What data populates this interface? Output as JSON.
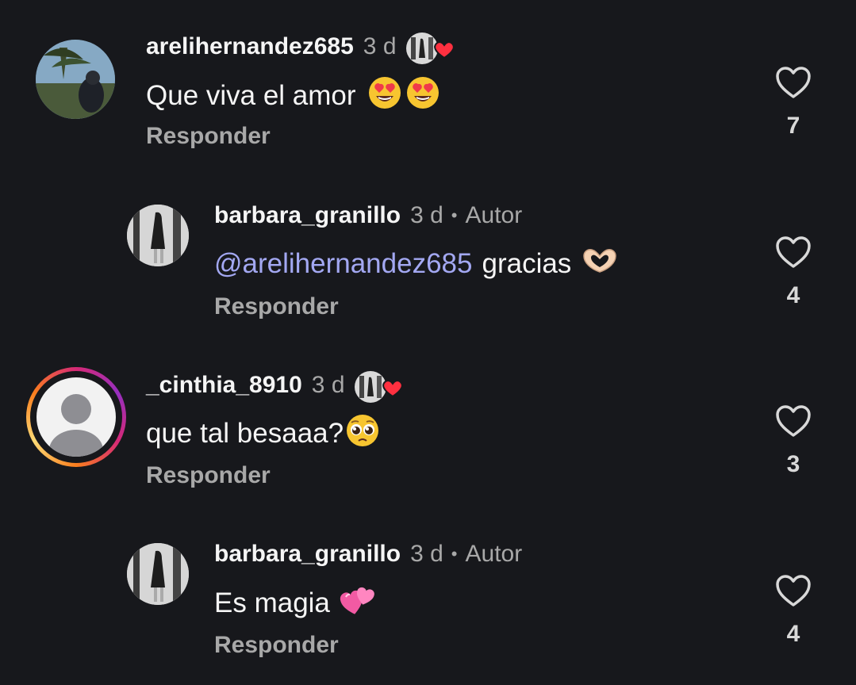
{
  "comments": [
    {
      "username": "arelihernandez685",
      "time": "3 d",
      "text": "Que viva el amor",
      "emojis": [
        "heart-eyes",
        "heart-eyes"
      ],
      "reply_label": "Responder",
      "likes": "7"
    },
    {
      "username": "barbara_granillo",
      "time": "3 d",
      "separator": "•",
      "author_label": "Autor",
      "mention": "@arelihernandez685",
      "text": "gracias",
      "emojis": [
        "heart-hands"
      ],
      "reply_label": "Responder",
      "likes": "4"
    },
    {
      "username": "_cinthia_8910",
      "time": "3 d",
      "text": "que tal besaaa?",
      "emojis": [
        "pleading-face"
      ],
      "reply_label": "Responder",
      "likes": "3"
    },
    {
      "username": "barbara_granillo",
      "time": "3 d",
      "separator": "•",
      "author_label": "Autor",
      "text": "Es magia",
      "emojis": [
        "two-hearts"
      ],
      "reply_label": "Responder",
      "likes": "4"
    }
  ],
  "colors": {
    "background": "#17181c",
    "mention": "#a3a8f2",
    "secondary_text": "#a8a8a8",
    "heart_red": "#ff3040"
  }
}
